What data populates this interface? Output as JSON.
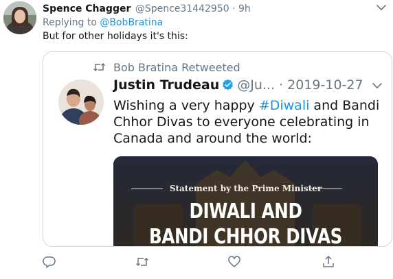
{
  "tweet": {
    "display_name": "Spence Chagger",
    "handle": "@Spence31442950",
    "separator": "·",
    "time": "9h",
    "reply_prefix": "Replying to",
    "reply_to": "@BobBratina",
    "text": "But for other holidays it's this:"
  },
  "quoted": {
    "retweeted_by": "Bob Bratina Retweeted",
    "display_name": "Justin Trudeau",
    "handle": "@Ju...",
    "separator": "·",
    "date": "2019-10-27",
    "text_before": "Wishing a very happy ",
    "hashtag": "#Diwali",
    "text_after": " and Bandi Chhor Divas to everyone celebrating in Canada and around the world:",
    "media": {
      "statement": "Statement by the Prime Minister",
      "title_line1": "DIWALI AND",
      "title_line2": "BANDI CHHOR DIVAS"
    }
  },
  "icons": {
    "reply": "reply-icon",
    "retweet": "retweet-icon",
    "like": "heart-icon",
    "share": "share-icon",
    "verified": "verified-badge-icon",
    "more": "chevron-down-icon"
  },
  "colors": {
    "link": "#1b95e0",
    "secondary_text": "#657786",
    "primary_text": "#14171a",
    "verified": "#1da1f2",
    "border": "#ccd6dd"
  }
}
